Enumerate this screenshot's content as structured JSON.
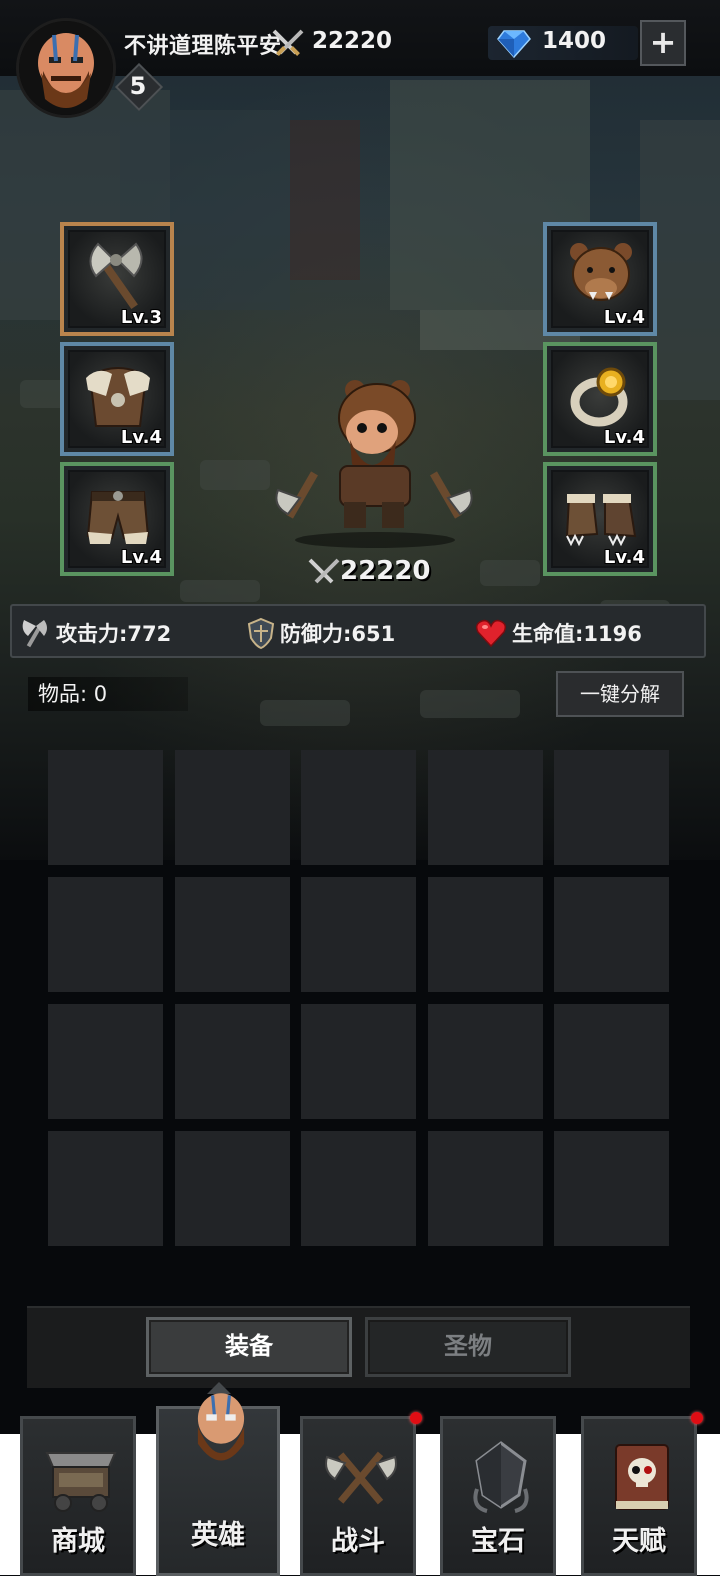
{
  "player": {
    "name": "不讲道理陈平安",
    "power": "22220",
    "level": "5",
    "avatar_icon": "bearded-warrior-portrait-icon"
  },
  "currency": {
    "gems": "1400",
    "gem_icon": "blue-diamond-icon",
    "plus_label": "+"
  },
  "equipment": {
    "left": [
      {
        "name": "axe",
        "icon": "battle-axe-icon",
        "level": "Lv.3",
        "rarity": "orange"
      },
      {
        "name": "armor",
        "icon": "fur-armor-icon",
        "level": "Lv.4",
        "rarity": "blue"
      },
      {
        "name": "pants",
        "icon": "fur-pants-icon",
        "level": "Lv.4",
        "rarity": "green"
      }
    ],
    "right": [
      {
        "name": "helmet",
        "icon": "bear-head-helmet-icon",
        "level": "Lv.4",
        "rarity": "blue"
      },
      {
        "name": "ring",
        "icon": "gold-ring-icon",
        "level": "Lv.4",
        "rarity": "green"
      },
      {
        "name": "boots",
        "icon": "fur-boots-icon",
        "level": "Lv.4",
        "rarity": "green"
      }
    ]
  },
  "hero": {
    "power": "22220",
    "sprite_icon": "bear-hood-barbarian-icon"
  },
  "stats": {
    "attack_label": "攻击力:",
    "attack_value": "772",
    "defense_label": "防御力:",
    "defense_value": "651",
    "hp_label": "生命值:",
    "hp_value": "1196"
  },
  "inventory": {
    "label": "物品:",
    "count": "0",
    "decompose_label": "一键分解",
    "cells": 20
  },
  "tabs": [
    {
      "label": "装备",
      "active": true
    },
    {
      "label": "圣物",
      "active": false
    }
  ],
  "nav": [
    {
      "label": "商城",
      "icon": "shop-cart-icon",
      "active": false,
      "notify": false
    },
    {
      "label": "英雄",
      "icon": "hero-portrait-icon",
      "active": true,
      "notify": false
    },
    {
      "label": "战斗",
      "icon": "crossed-axes-icon",
      "active": false,
      "notify": true
    },
    {
      "label": "宝石",
      "icon": "gem-crystal-icon",
      "active": false,
      "notify": false
    },
    {
      "label": "天赋",
      "icon": "skull-book-icon",
      "active": false,
      "notify": true
    }
  ],
  "colors": {
    "rarity_orange": "#b9844d",
    "rarity_blue": "#5f88a6",
    "rarity_green": "#5a9460",
    "notify_red": "#e00d14",
    "gem_blue": "#2e7bdc"
  }
}
